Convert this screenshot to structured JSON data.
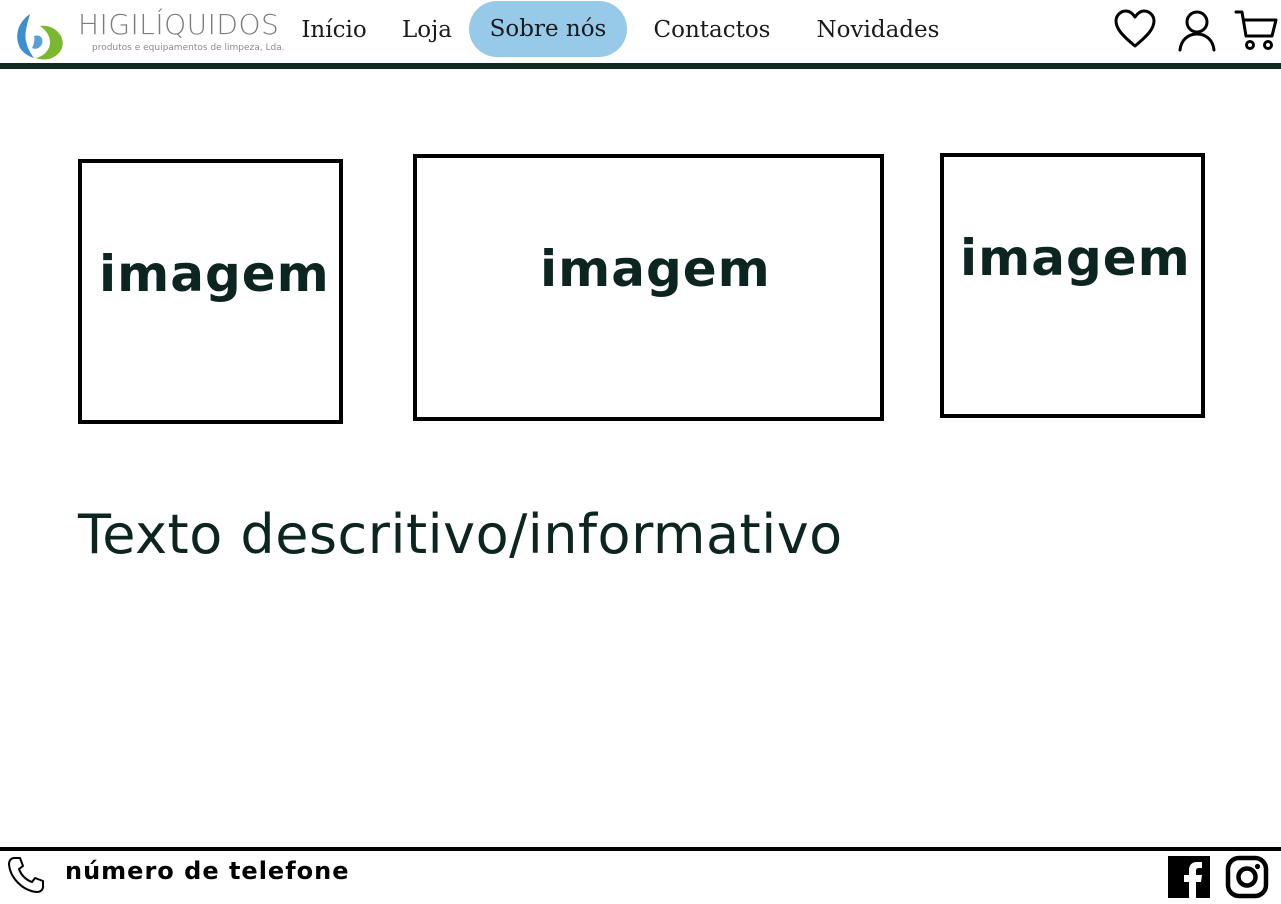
{
  "brand": {
    "name": "HIGILÍQUIDOS",
    "tagline": "produtos e equipamentos de limpeza, Lda.",
    "colors": {
      "blue": "#3d8fd0",
      "green": "#7ab82f",
      "active_pill": "#97c9e8",
      "dark": "#0e2a22"
    }
  },
  "nav": {
    "items": [
      {
        "label": "Início",
        "active": false
      },
      {
        "label": "Loja",
        "active": false
      },
      {
        "label": "Sobre nós",
        "active": true
      },
      {
        "label": "Contactos",
        "active": false
      },
      {
        "label": "Novidades",
        "active": false
      }
    ]
  },
  "header_icons": [
    "heart-icon",
    "user-icon",
    "cart-icon"
  ],
  "gallery": [
    {
      "label": "imagem"
    },
    {
      "label": "imagem"
    },
    {
      "label": "imagem"
    }
  ],
  "description": "Texto descritivo/informativo",
  "footer": {
    "phone_label": "número de telefone",
    "icons": [
      "phone-icon",
      "facebook-icon",
      "instagram-icon"
    ]
  }
}
